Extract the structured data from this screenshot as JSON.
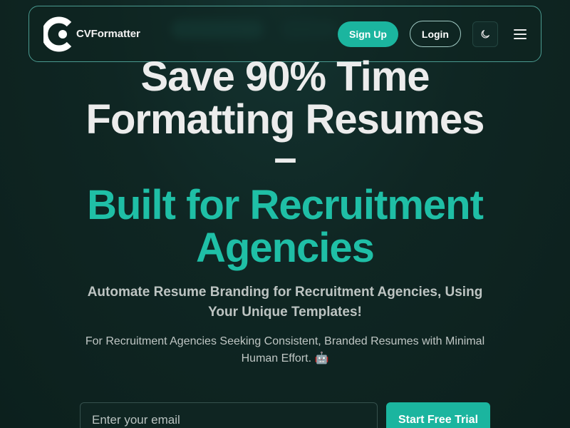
{
  "header": {
    "brand": "CVFormatter",
    "signup_label": "Sign Up",
    "login_label": "Login",
    "theme_icon": "moon-icon",
    "menu_icon": "hamburger-menu-icon"
  },
  "hero": {
    "title_line1": "Save 90% Time",
    "title_line2": "Formatting Resumes",
    "title_dash": "–",
    "accent_line1": "Built for Recruitment",
    "accent_line2": "Agencies",
    "subtitle": "Automate Resume Branding for Recruitment Agencies, Using Your Unique Templates!",
    "description": "For Recruitment Agencies Seeking Consistent, Branded Resumes with Minimal Human Effort. 🤖"
  },
  "signup_form": {
    "email_placeholder": "Enter your email",
    "email_value": "",
    "cta_label": "Start Free Trial"
  },
  "colors": {
    "background": "#0e2421",
    "accent": "#1bb59f",
    "heading": "#ececec",
    "border": "#4a9a90"
  }
}
